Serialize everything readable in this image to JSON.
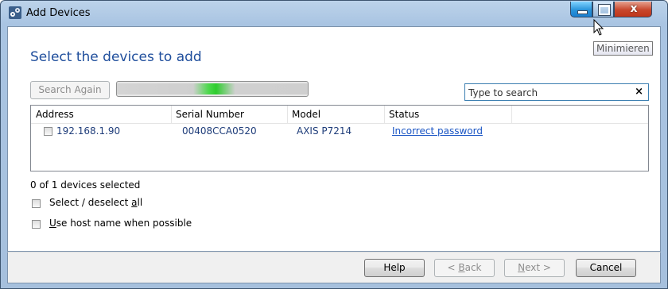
{
  "window": {
    "title": "Add Devices",
    "controls": {
      "minimize_tooltip": "Minimieren",
      "close_glyph": "x"
    }
  },
  "heading": "Select the devices to add",
  "toolbar": {
    "search_again_label": "Search Again",
    "search_again_enabled": false,
    "search_placeholder": "Type to search",
    "search_value": "",
    "clear_glyph": "×"
  },
  "list": {
    "columns": [
      "Address",
      "Serial Number",
      "Model",
      "Status"
    ],
    "rows": [
      {
        "address": "192.168.1.90",
        "serial": "00408CCA0520",
        "model": "AXIS P7214",
        "status": "Incorrect password",
        "checked": false
      }
    ]
  },
  "selection": {
    "count_text": "0 of 1 devices selected"
  },
  "options": {
    "select_all_pre": "Select / deselect ",
    "select_all_access": "a",
    "select_all_post": "ll",
    "hostname_access": "U",
    "hostname_post": "se host name when possible"
  },
  "footer": {
    "help_label": "Help",
    "back_pre": "< ",
    "back_access": "B",
    "back_post": "ack",
    "next_access": "N",
    "next_post": "ext >",
    "cancel_label": "Cancel"
  },
  "colors": {
    "heading": "#1f4e9c",
    "link": "#1a55c4",
    "progress_highlight": "#2ecc2e"
  },
  "icons": [
    "devices-icon",
    "minimize-icon",
    "maximize-icon",
    "close-icon",
    "clear-search-icon",
    "mouse-cursor-icon"
  ]
}
